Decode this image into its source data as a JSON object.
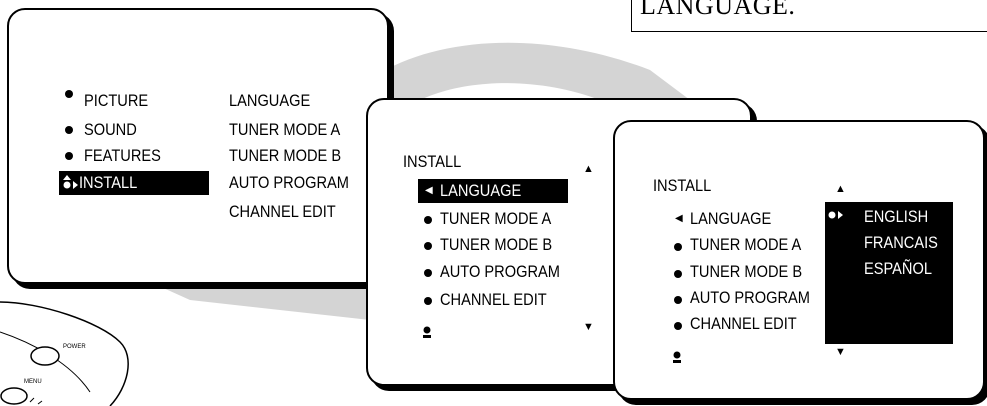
{
  "caption": {
    "text": "LANGUAGE."
  },
  "screen1": {
    "main_menu": [
      "PICTURE",
      "SOUND",
      "FEATURES",
      "INSTALL"
    ],
    "submenu": [
      "LANGUAGE",
      "TUNER MODE A",
      "TUNER MODE B",
      "AUTO PROGRAM",
      "CHANNEL EDIT"
    ]
  },
  "screen2": {
    "title": "INSTALL",
    "items": [
      "LANGUAGE",
      "TUNER MODE A",
      "TUNER MODE B",
      "AUTO PROGRAM",
      "CHANNEL EDIT"
    ]
  },
  "screen3": {
    "title": "INSTALL",
    "items": [
      "LANGUAGE",
      "TUNER MODE A",
      "TUNER MODE B",
      "AUTO PROGRAM",
      "CHANNEL EDIT"
    ],
    "options": [
      "ENGLISH",
      "FRANCAIS",
      "ESPAÑOL"
    ]
  },
  "remote": {
    "button_labels": [
      "POWER",
      "MENU"
    ]
  },
  "colors": {
    "ink": "#000000",
    "background": "#ffffff",
    "swoosh": "#d4d4d4"
  }
}
